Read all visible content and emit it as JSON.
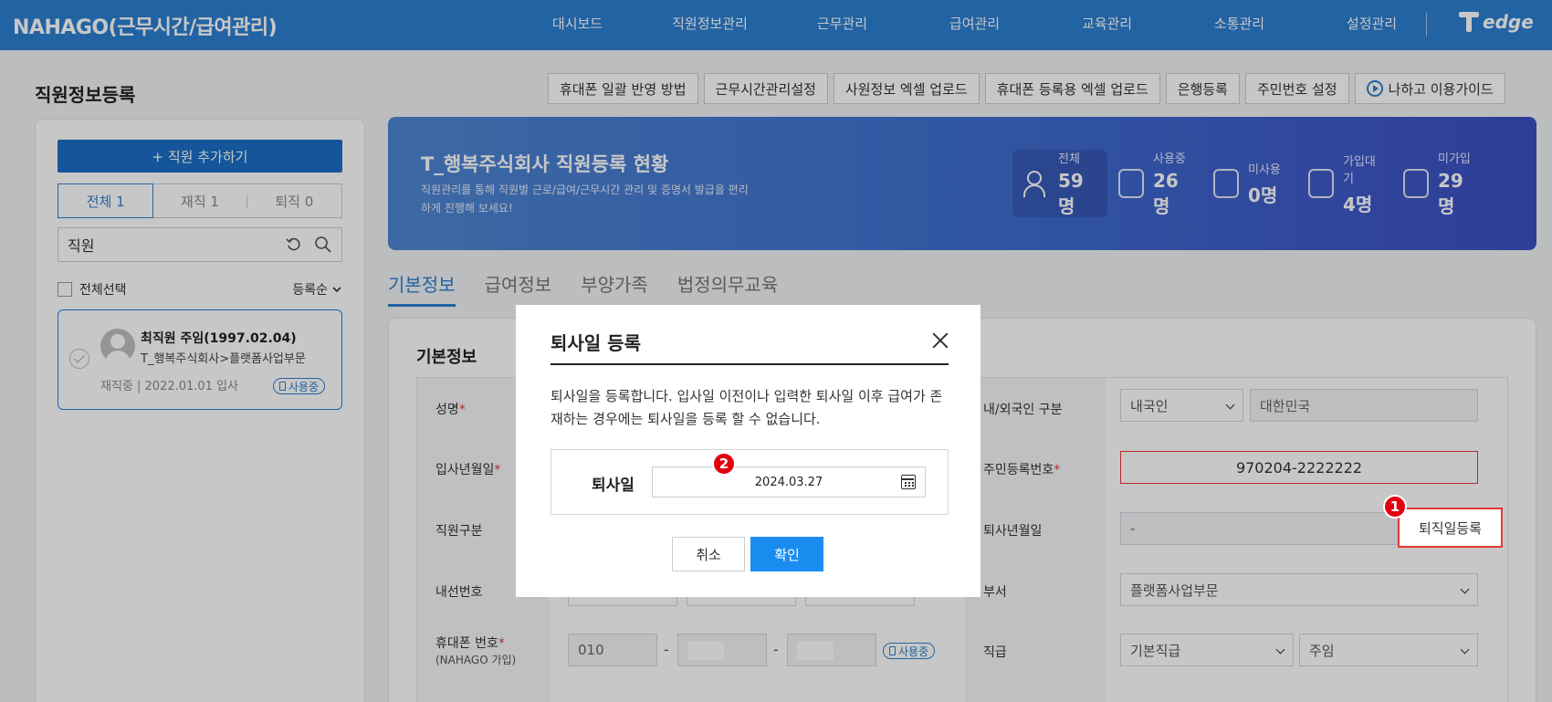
{
  "app": {
    "title": "NAHAGO(근무시간/급여관리)",
    "logo_text": "edge"
  },
  "nav": [
    "대시보드",
    "직원정보관리",
    "근무관리",
    "급여관리",
    "교육관리",
    "소통관리",
    "설정관리"
  ],
  "page": {
    "title": "직원정보등록"
  },
  "toolbar": [
    "휴대폰 일괄 반영 방법",
    "근무시간관리설정",
    "사원정보 엑셀 업로드",
    "휴대폰 등록용 엑셀 업로드",
    "은행등록",
    "주민번호 설정"
  ],
  "guide_button": "나하고 이용가이드",
  "sidebar": {
    "add_button": "+ 직원 추가하기",
    "filters": [
      "전체 1",
      "재직 1",
      "퇴직 0"
    ],
    "search_value": "직원",
    "select_all": "전체선택",
    "sort": "등록순",
    "employee": {
      "name": "최직원 주임(1997.02.04)",
      "org": "T_행복주식회사>플랫폼사업부문",
      "status": "재직중 | 2022.01.01 입사",
      "badge": "사용중"
    }
  },
  "banner": {
    "title": "T_행복주식회사 직원등록 현황",
    "desc": "직원관리를 통해 직원별 근로/급여/근무시간 관리 및 증명서 발급을 편리하게 진행해 보세요!",
    "stats": [
      {
        "label": "전체",
        "value": "59명",
        "icon": "people-icon"
      },
      {
        "label": "사용중",
        "value": "26명",
        "icon": "phone-check-icon"
      },
      {
        "label": "미사용",
        "value": "0명",
        "icon": "phone-x-icon"
      },
      {
        "label": "가입대기",
        "value": "4명",
        "icon": "phone-wait-icon"
      },
      {
        "label": "미가입",
        "value": "29명",
        "icon": "phone-x-icon"
      }
    ]
  },
  "tabs": [
    "기본정보",
    "급여정보",
    "부양가족",
    "법정의무교육"
  ],
  "form": {
    "section_title": "기본정보",
    "left_labels": {
      "name": "성명",
      "hire_date": "입사년월일",
      "emp_type": "직원구분",
      "extension": "내선번호",
      "mobile": "휴대폰 번호",
      "mobile_sub": "(NAHAGO 가입)"
    },
    "right_labels": {
      "nationality": "내/외국인 구분",
      "rrn": "주민등록번호",
      "retire_date": "퇴사년월일",
      "dept": "부서",
      "position": "직급"
    },
    "required_mark": "*",
    "nationality_select": "내국인",
    "country": "대한민국",
    "rrn_value": "970204-2222222",
    "retire_value": "-",
    "dept_select": "플랫폼사업부문",
    "position_select": "기본직급",
    "rank_select": "주임",
    "mobile_prefix": "010",
    "dash": "-",
    "mobile_badge": "사용중"
  },
  "retire_button": "퇴직일등록",
  "markers": [
    "1",
    "2"
  ],
  "modal": {
    "title": "퇴사일 등록",
    "message": "퇴사일을 등록합니다. 입사일 이전이나 입력한 퇴사일 이후 급여가 존재하는 경우에는 퇴사일을 등록 할 수 없습니다.",
    "field_label": "퇴사일",
    "date_value": "2024.03.27",
    "cancel": "취소",
    "confirm": "확인"
  }
}
